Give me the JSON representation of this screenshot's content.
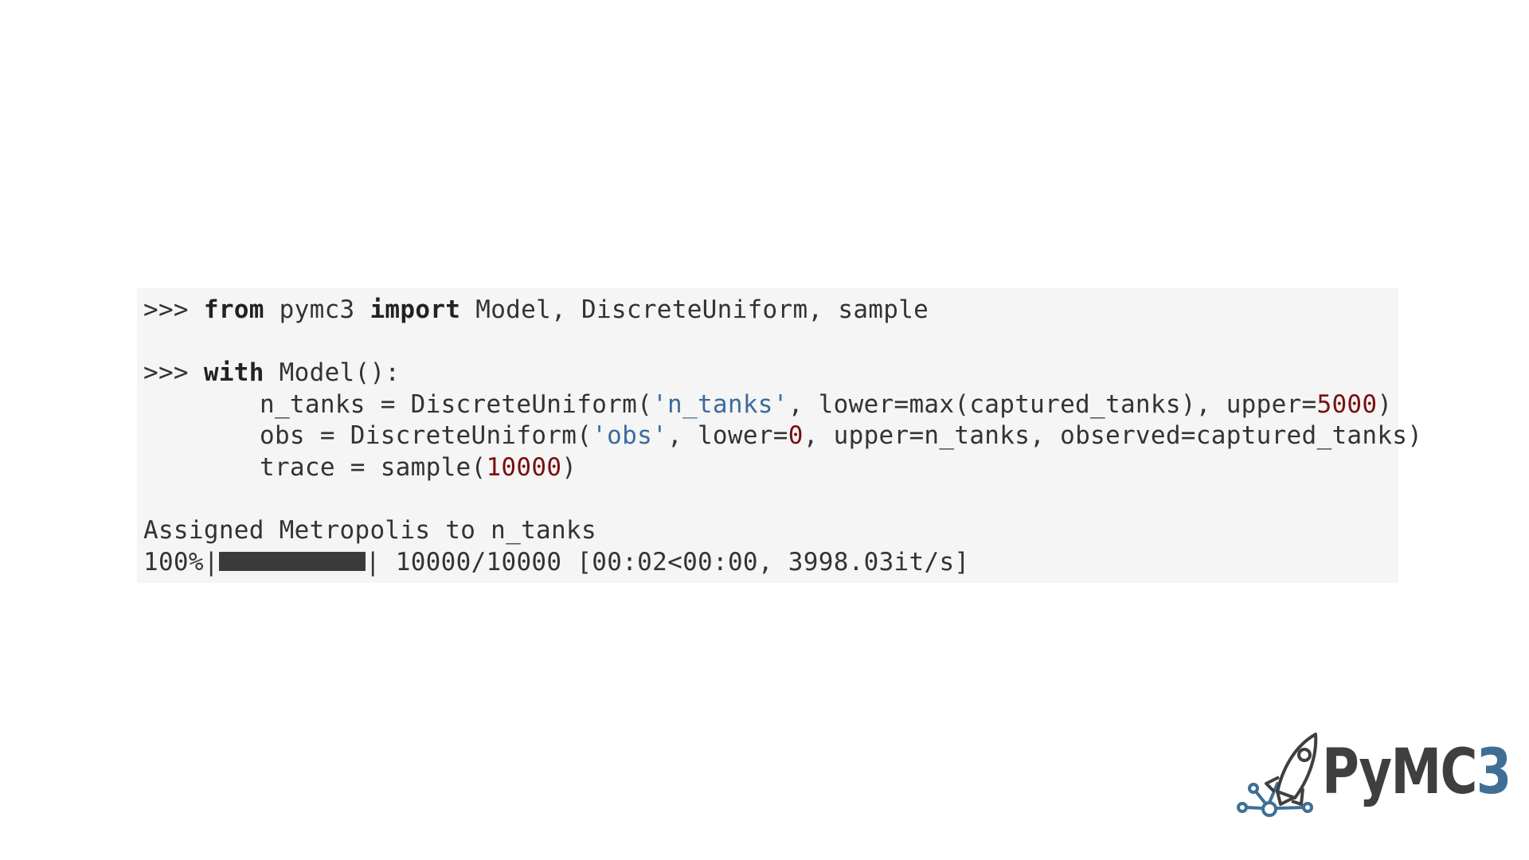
{
  "code": {
    "line1": {
      "prompt": ">>> ",
      "kw_from": "from",
      "module": " pymc3 ",
      "kw_import": "import",
      "names": " Model, DiscreteUniform, sample"
    },
    "line2": {
      "prompt": ">>> ",
      "kw_with": "with",
      "rest": " Model():"
    },
    "line3": {
      "a": "n_tanks = DiscreteUniform(",
      "str": "'n_tanks'",
      "b": ", lower=max(captured_tanks), upper=",
      "num": "5000",
      "c": ")"
    },
    "line4": {
      "a": "obs = DiscreteUniform(",
      "str": "'obs'",
      "b": ", lower=",
      "num": "0",
      "c": ", upper=n_tanks, observed=captured_tanks)"
    },
    "line5": {
      "a": "trace = sample(",
      "num": "10000",
      "c": ")"
    },
    "output1": "Assigned Metropolis to n_tanks",
    "progress": {
      "percent_text": "100%|",
      "fraction": 1.0,
      "after_bar": "| 10000/10000 [00:02<00:00, 3998.03it/s]"
    }
  },
  "logo": {
    "text_main": "PyMC",
    "text_accent": "3",
    "icon": "rocket-icon",
    "colors": {
      "dark": "#3f3f3f",
      "accent": "#3f6f94"
    }
  }
}
